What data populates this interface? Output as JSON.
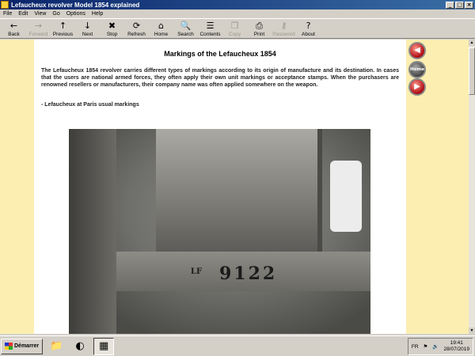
{
  "window": {
    "title": "Lefaucheux revolver Model 1854 explained"
  },
  "menu": [
    "File",
    "Edit",
    "View",
    "Go",
    "Options",
    "Help"
  ],
  "toolbar": [
    {
      "label": "Back",
      "icon": "←",
      "disabled": false,
      "name": "back"
    },
    {
      "label": "Forward",
      "icon": "→",
      "disabled": true,
      "name": "forward"
    },
    {
      "label": "Previous",
      "icon": "↑",
      "disabled": false,
      "name": "previous"
    },
    {
      "label": "Next",
      "icon": "↓",
      "disabled": false,
      "name": "next"
    },
    {
      "label": "Stop",
      "icon": "✖",
      "disabled": false,
      "name": "stop"
    },
    {
      "label": "Refresh",
      "icon": "⟳",
      "disabled": false,
      "name": "refresh"
    },
    {
      "label": "Home",
      "icon": "⌂",
      "disabled": false,
      "name": "home"
    },
    {
      "label": "Search",
      "icon": "🔍",
      "disabled": false,
      "name": "search"
    },
    {
      "label": "Contents",
      "icon": "☰",
      "disabled": false,
      "name": "contents"
    },
    {
      "label": "Copy",
      "icon": "❐",
      "disabled": true,
      "name": "copy"
    },
    {
      "label": "Print",
      "icon": "⎙",
      "disabled": false,
      "name": "print"
    },
    {
      "label": "Password",
      "icon": "⚷",
      "disabled": true,
      "name": "password"
    },
    {
      "label": "About",
      "icon": "?",
      "disabled": false,
      "name": "about"
    }
  ],
  "page": {
    "title": "Markings of the Lefaucheux 1854",
    "intro": "The Lefaucheux 1854 revolver carries different types of markings according to its origin of manufacture and its destination. In cases that the users are national armed forces, they often apply their own unit markings or acceptance stamps. When the purchasers are renowned resellers or manufacturers, their company name was often applied somewhere on the weapon.",
    "section": "- Lefaucheux at Paris usual markings",
    "photo_serial": "9122",
    "photo_mark": "LF"
  },
  "nav": {
    "home_label": "Home"
  },
  "taskbar": {
    "start_label": "Démarrer",
    "lang": "FR",
    "time": "19:41",
    "date": "28/07/2019"
  },
  "colors": {
    "content_bg": "#fbeeb0",
    "titlebar": "#0a246a"
  }
}
